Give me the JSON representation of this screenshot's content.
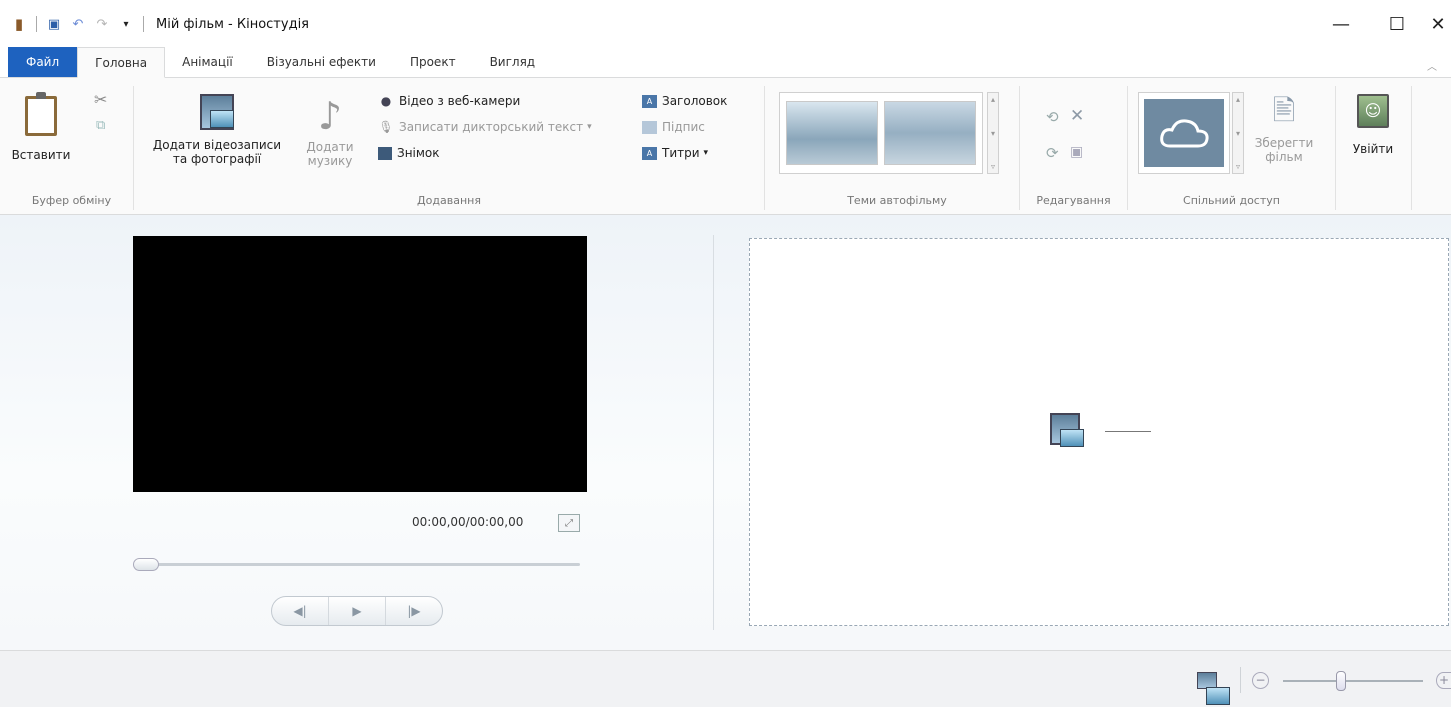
{
  "window": {
    "title": "Мій фільм - Кіностудія",
    "minimize": "—",
    "maximize": "☐",
    "close": "✕"
  },
  "tabs": [
    {
      "label": "Файл"
    },
    {
      "label": "Головна"
    },
    {
      "label": "Анімації"
    },
    {
      "label": "Візуальні ефекти"
    },
    {
      "label": "Проект"
    },
    {
      "label": "Вигляд"
    }
  ],
  "ribbon": {
    "clipboard": {
      "group_label": "Буфер обміну",
      "paste_label": "Вставити"
    },
    "add": {
      "group_label": "Додавання",
      "add_videos_line1": "Додати відеозаписи",
      "add_videos_line2": "та фотографії",
      "add_music_line1": "Додати",
      "add_music_line2": "музику",
      "webcam": "Відео з веб-камери",
      "narration": "Записати дикторський текст",
      "snapshot": "Знімок",
      "title": "Заголовок",
      "caption": "Підпис",
      "credits": "Титри"
    },
    "themes": {
      "group_label": "Теми автофільму"
    },
    "editing": {
      "group_label": "Редагування"
    },
    "share": {
      "group_label": "Спільний доступ",
      "save_line1": "Зберегти",
      "save_line2": "фільм"
    },
    "signin": {
      "label": "Увійти"
    }
  },
  "preview": {
    "timecode": "00:00,00/00:00,00"
  },
  "colors": {
    "file_tab": "#1e62bf",
    "video_bg": "#000000"
  }
}
